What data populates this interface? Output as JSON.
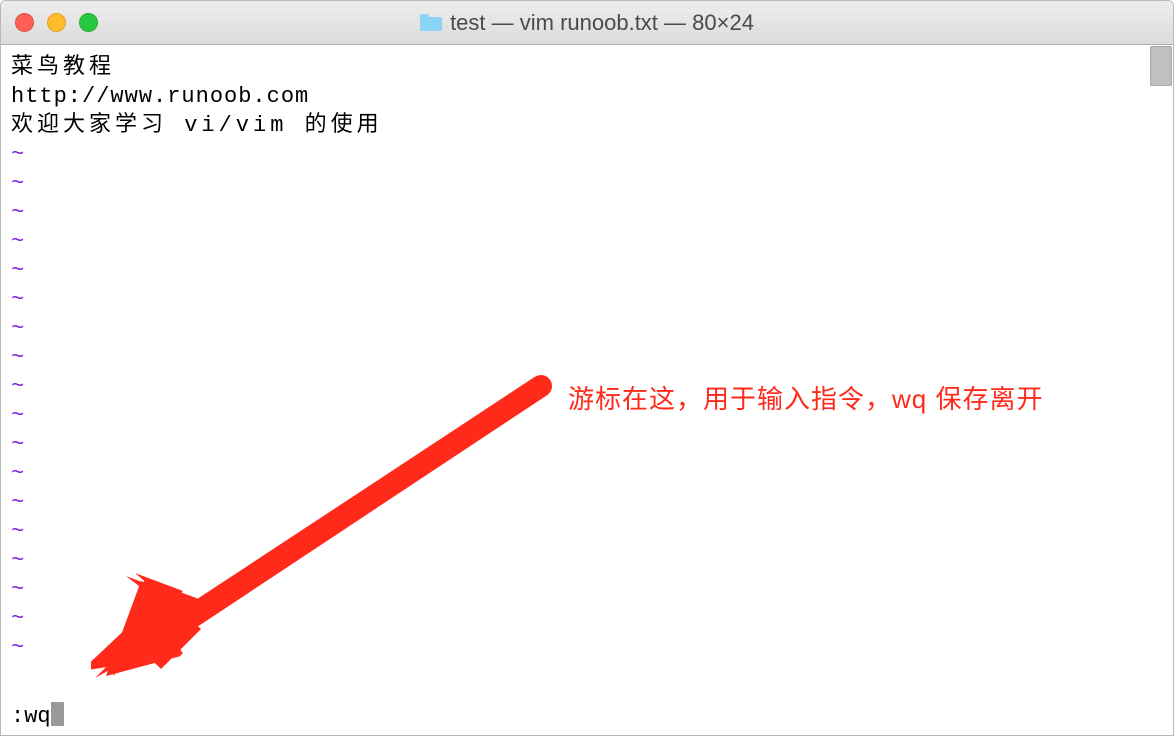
{
  "titlebar": {
    "title": "test — vim runoob.txt — 80×24"
  },
  "editor": {
    "lines": [
      "菜鸟教程",
      "http://www.runoob.com",
      "欢迎大家学习 vi/vim 的使用"
    ],
    "tilde": "~",
    "tilde_count": 18,
    "command": ":wq"
  },
  "annotation": {
    "text": "游标在这，用于输入指令，wq 保存离开"
  }
}
